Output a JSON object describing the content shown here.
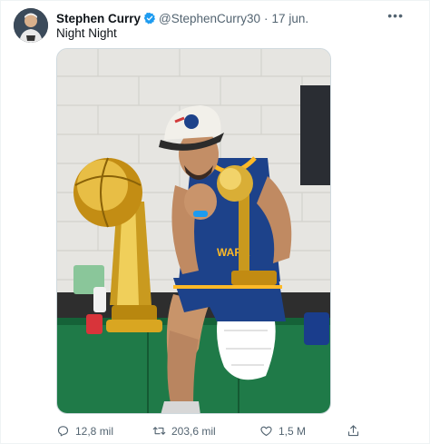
{
  "tweet": {
    "author_name": "Stephen Curry",
    "author_handle": "@StephenCurry30",
    "separator": "·",
    "date": "17 jun.",
    "more_label": "•••",
    "text": "Night Night"
  },
  "actions": {
    "replies": "12,8 mil",
    "retweets": "203,6 mil",
    "likes": "1,5 M"
  },
  "colors": {
    "verified": "#1d9bf0",
    "muted": "#536471",
    "text": "#0f1419"
  },
  "icons": {
    "verified": "verified-badge-icon",
    "reply": "reply-icon",
    "retweet": "retweet-icon",
    "like": "heart-icon",
    "share": "share-icon",
    "more": "more-dots-icon"
  }
}
